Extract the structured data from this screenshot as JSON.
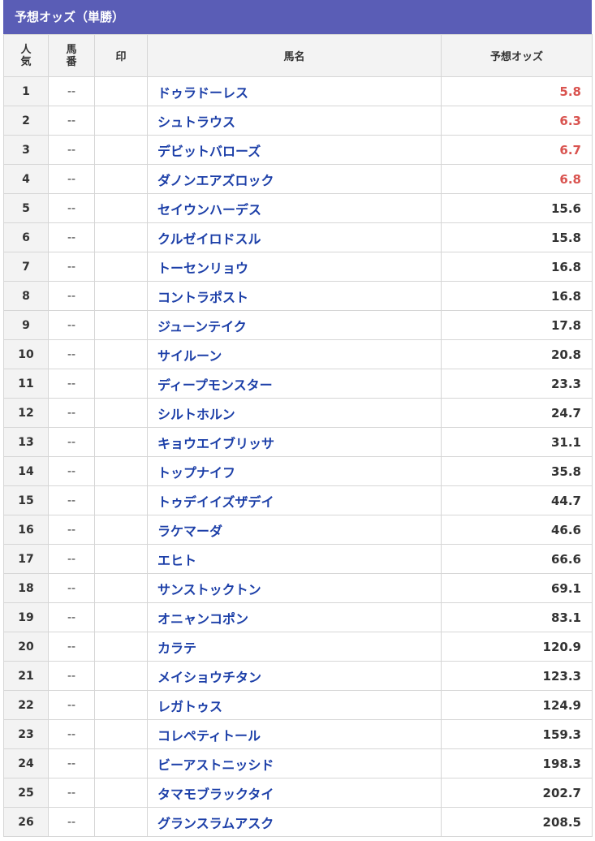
{
  "header": {
    "title": "予想オッズ（単勝）"
  },
  "columns": {
    "popularity_line1": "人",
    "popularity_line2": "気",
    "number_line1": "馬",
    "number_line2": "番",
    "mark": "印",
    "name": "馬名",
    "odds": "予想オッズ"
  },
  "colors": {
    "header_bg": "#5a5db6",
    "name_text": "#1c3fa8",
    "hot_odds": "#d9534f",
    "normal_odds": "#333333"
  },
  "rows": [
    {
      "pop": "1",
      "num": "--",
      "mark": "",
      "name": "ドゥラドーレス",
      "odds": "5.8",
      "hot": true
    },
    {
      "pop": "2",
      "num": "--",
      "mark": "",
      "name": "シュトラウス",
      "odds": "6.3",
      "hot": true
    },
    {
      "pop": "3",
      "num": "--",
      "mark": "",
      "name": "デビットバローズ",
      "odds": "6.7",
      "hot": true
    },
    {
      "pop": "4",
      "num": "--",
      "mark": "",
      "name": "ダノンエアズロック",
      "odds": "6.8",
      "hot": true
    },
    {
      "pop": "5",
      "num": "--",
      "mark": "",
      "name": "セイウンハーデス",
      "odds": "15.6",
      "hot": false
    },
    {
      "pop": "6",
      "num": "--",
      "mark": "",
      "name": "クルゼイロドスル",
      "odds": "15.8",
      "hot": false
    },
    {
      "pop": "7",
      "num": "--",
      "mark": "",
      "name": "トーセンリョウ",
      "odds": "16.8",
      "hot": false
    },
    {
      "pop": "8",
      "num": "--",
      "mark": "",
      "name": "コントラポスト",
      "odds": "16.8",
      "hot": false
    },
    {
      "pop": "9",
      "num": "--",
      "mark": "",
      "name": "ジューンテイク",
      "odds": "17.8",
      "hot": false
    },
    {
      "pop": "10",
      "num": "--",
      "mark": "",
      "name": "サイルーン",
      "odds": "20.8",
      "hot": false
    },
    {
      "pop": "11",
      "num": "--",
      "mark": "",
      "name": "ディープモンスター",
      "odds": "23.3",
      "hot": false
    },
    {
      "pop": "12",
      "num": "--",
      "mark": "",
      "name": "シルトホルン",
      "odds": "24.7",
      "hot": false
    },
    {
      "pop": "13",
      "num": "--",
      "mark": "",
      "name": "キョウエイブリッサ",
      "odds": "31.1",
      "hot": false
    },
    {
      "pop": "14",
      "num": "--",
      "mark": "",
      "name": "トップナイフ",
      "odds": "35.8",
      "hot": false
    },
    {
      "pop": "15",
      "num": "--",
      "mark": "",
      "name": "トゥデイイズザデイ",
      "odds": "44.7",
      "hot": false
    },
    {
      "pop": "16",
      "num": "--",
      "mark": "",
      "name": "ラケマーダ",
      "odds": "46.6",
      "hot": false
    },
    {
      "pop": "17",
      "num": "--",
      "mark": "",
      "name": "エヒト",
      "odds": "66.6",
      "hot": false
    },
    {
      "pop": "18",
      "num": "--",
      "mark": "",
      "name": "サンストックトン",
      "odds": "69.1",
      "hot": false
    },
    {
      "pop": "19",
      "num": "--",
      "mark": "",
      "name": "オニャンコポン",
      "odds": "83.1",
      "hot": false
    },
    {
      "pop": "20",
      "num": "--",
      "mark": "",
      "name": "カラテ",
      "odds": "120.9",
      "hot": false
    },
    {
      "pop": "21",
      "num": "--",
      "mark": "",
      "name": "メイショウチタン",
      "odds": "123.3",
      "hot": false
    },
    {
      "pop": "22",
      "num": "--",
      "mark": "",
      "name": "レガトゥス",
      "odds": "124.9",
      "hot": false
    },
    {
      "pop": "23",
      "num": "--",
      "mark": "",
      "name": "コレペティトール",
      "odds": "159.3",
      "hot": false
    },
    {
      "pop": "24",
      "num": "--",
      "mark": "",
      "name": "ビーアストニッシド",
      "odds": "198.3",
      "hot": false
    },
    {
      "pop": "25",
      "num": "--",
      "mark": "",
      "name": "タマモブラックタイ",
      "odds": "202.7",
      "hot": false
    },
    {
      "pop": "26",
      "num": "--",
      "mark": "",
      "name": "グランスラムアスク",
      "odds": "208.5",
      "hot": false
    }
  ]
}
